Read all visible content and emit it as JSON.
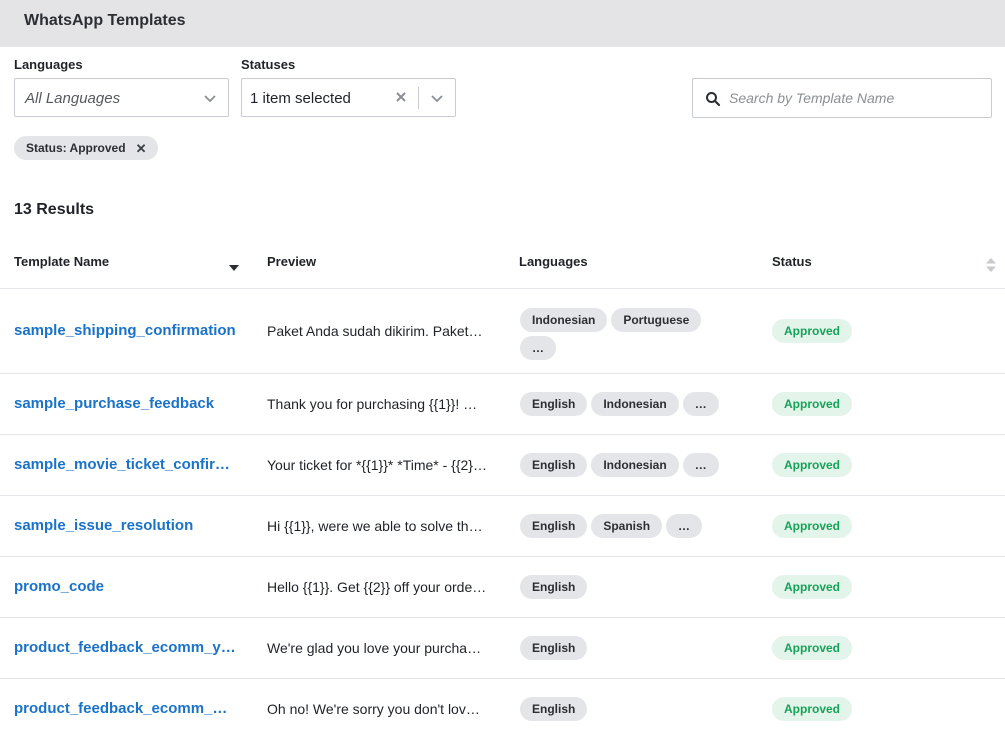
{
  "header": {
    "title": "WhatsApp Templates"
  },
  "filters": {
    "languages": {
      "label": "Languages",
      "placeholder": "All Languages"
    },
    "statuses": {
      "label": "Statuses",
      "value": "1 item selected"
    },
    "search": {
      "placeholder": "Search by Template Name"
    },
    "active_chip": "Status: Approved"
  },
  "results_label": "13 Results",
  "table": {
    "columns": {
      "name": "Template Name",
      "preview": "Preview",
      "languages": "Languages",
      "status": "Status"
    },
    "rows": [
      {
        "name": "sample_shipping_confirmation",
        "preview": "Paket Anda sudah dikirim. Paket…",
        "languages": [
          "Indonesian",
          "Portuguese",
          "…"
        ],
        "status": "Approved"
      },
      {
        "name": "sample_purchase_feedback",
        "preview": "Thank you for purchasing {{1}}! …",
        "languages": [
          "English",
          "Indonesian",
          "…"
        ],
        "status": "Approved"
      },
      {
        "name": "sample_movie_ticket_confir…",
        "preview": "Your ticket for *{{1}}* *Time* - {{2}} …",
        "languages": [
          "English",
          "Indonesian",
          "…"
        ],
        "status": "Approved"
      },
      {
        "name": "sample_issue_resolution",
        "preview": "Hi {{1}}, were we able to solve the…",
        "languages": [
          "English",
          "Spanish",
          "…"
        ],
        "status": "Approved"
      },
      {
        "name": "promo_code",
        "preview": "Hello {{1}}. Get {{2}} off your order …",
        "languages": [
          "English"
        ],
        "status": "Approved"
      },
      {
        "name": "product_feedback_ecomm_y…",
        "preview": "We're glad you love your purcha…",
        "languages": [
          "English"
        ],
        "status": "Approved"
      },
      {
        "name": "product_feedback_ecomm_n…",
        "preview": "Oh no! We're sorry you don't lov…",
        "languages": [
          "English"
        ],
        "status": "Approved"
      }
    ]
  },
  "colors": {
    "link": "#1a72c9",
    "status_bg": "#e3f5ea",
    "status_text": "#18a15a",
    "header_bg": "#e4e4e7"
  }
}
